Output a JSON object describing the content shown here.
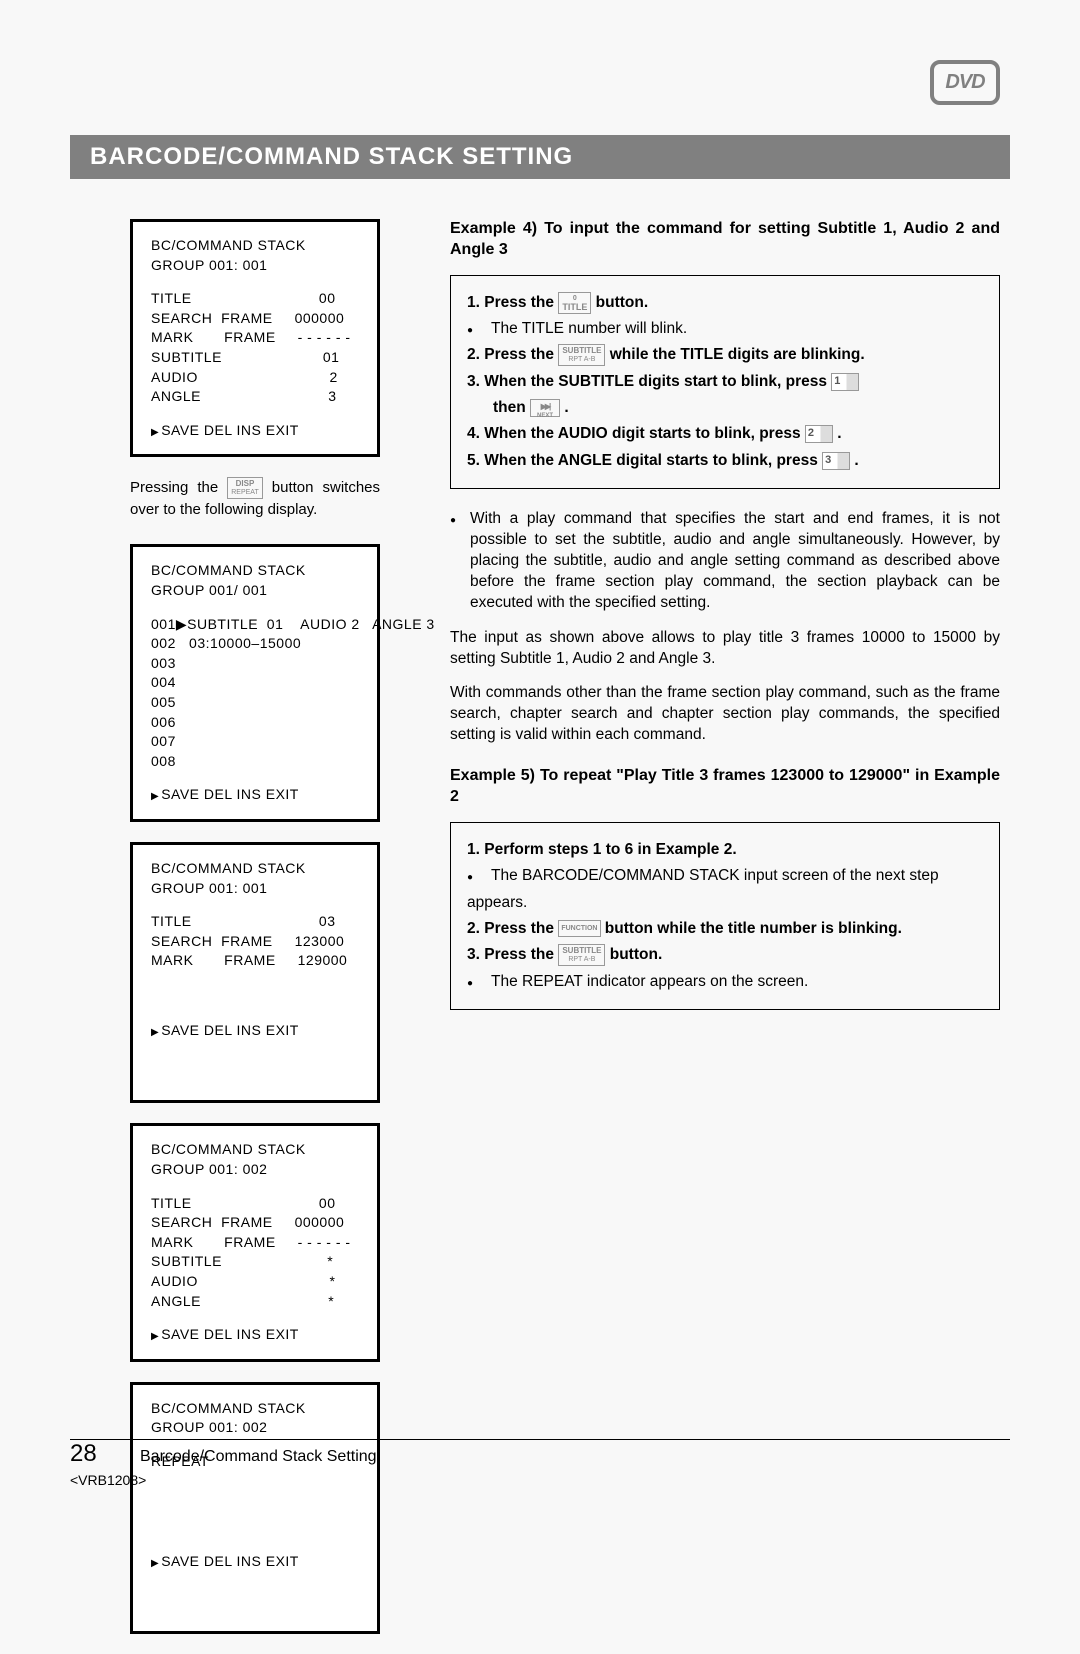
{
  "logo": "DVD",
  "title": "BARCODE/COMMAND STACK SETTING",
  "screen1": {
    "header": "BC/COMMAND STACK  GROUP  001: 001",
    "lines": [
      "TITLE                             00",
      "SEARCH  FRAME     000000",
      "MARK       FRAME     - - - - - -",
      "SUBTITLE                       01",
      "AUDIO                              2",
      "ANGLE                             3"
    ],
    "footer": "SAVE   DEL     INS     EXIT"
  },
  "between": {
    "pre": "Pressing the ",
    "btn_top": "DISP",
    "btn_bot": "REPEAT",
    "post": " button switches over to the following display."
  },
  "screen2": {
    "header": "BC/COMMAND STACK  GROUP  001/ 001",
    "lines": [
      "001▶SUBTITLE  01    AUDIO 2   ANGLE 3",
      "002   03:10000–15000",
      "003",
      "004",
      "005",
      "006",
      "007",
      "008"
    ],
    "footer": "SAVE   DEL     INS      EXIT"
  },
  "screen3": {
    "header": "BC/COMMAND STACK  GROUP  001: 001",
    "lines": [
      "TITLE                             03",
      "SEARCH  FRAME     123000",
      "MARK       FRAME     129000"
    ],
    "footer": "SAVE   DEL     INS     EXIT"
  },
  "screen4": {
    "header": "BC/COMMAND STACK  GROUP  001: 002",
    "lines": [
      "TITLE                             00",
      "SEARCH  FRAME     000000",
      "MARK       FRAME     - - - - - -",
      "SUBTITLE                        *",
      "AUDIO                              *",
      "ANGLE                             *"
    ],
    "footer": "SAVE   DEL     INS     EXIT"
  },
  "screen5": {
    "header": "BC/COMMAND STACK  GROUP  001: 002",
    "lines": [
      "REPEAT"
    ],
    "footer": "SAVE   DEL     INS     EXIT"
  },
  "example4": {
    "heading": "Example 4) To input the command for setting Subtitle 1, Audio 2 and Angle 3",
    "s1a": "1.   Press the ",
    "s1_btn_top": "0",
    "s1_btn_bot": "TITLE",
    "s1b": " button.",
    "s1_note": "The TITLE number will blink.",
    "s2a": "2.  Press the ",
    "s2_btn_top": "SUBTITLE",
    "s2_btn_bot": "RPT A-B",
    "s2b": " while the TITLE digits are blinking.",
    "s3a": "3.  When the SUBTITLE digits start to blink, press ",
    "s3_btn": "1",
    "s3b": "then ",
    "s3c": " .",
    "s4a": "4.  When the AUDIO digit starts to blink, press ",
    "s4_btn": "2",
    "s4b": " .",
    "s5a": "5.  When the ANGLE digital starts to blink, press ",
    "s5_btn": "3",
    "s5b": " ."
  },
  "note1": "With a play command that specifies the start and end frames, it is not possible to set the subtitle, audio and angle simultaneously. However, by placing the subtitle, audio and angle setting command as described above before the frame section play command, the section playback can be executed with the specified setting.",
  "para1": "The input as shown above allows to play title 3 frames 10000 to 15000 by setting Subtitle 1, Audio 2 and Angle 3.",
  "para2": "With commands other than the frame section play command, such as the frame search, chapter search and chapter section play commands, the specified setting is valid within each command.",
  "example5": {
    "heading": "Example 5) To repeat \"Play Title 3 frames 123000 to 129000\" in Example 2",
    "s1": "1.  Perform steps 1 to 6 in Example 2.",
    "s1_note": "The BARCODE/COMMAND STACK input screen of the next step appears.",
    "s2a": "2.  Press the ",
    "s2_btn": "FUNCTION",
    "s2b": " button while the title number is blinking.",
    "s3a": "3.  Press the ",
    "s3_btn_top": "SUBTITLE",
    "s3_btn_bot": "RPT A-B",
    "s3b": " button.",
    "s3_note": "The REPEAT indicator appears on the screen."
  },
  "footer": {
    "page": "28",
    "title": "Barcode/Command Stack Setting",
    "ref": "<VRB1208>"
  }
}
